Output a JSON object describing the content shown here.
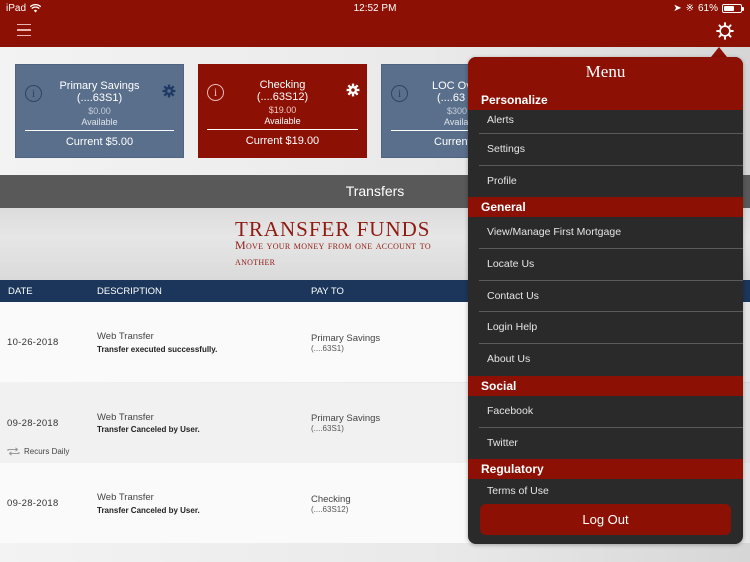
{
  "status_bar": {
    "device": "iPad",
    "time": "12:52 PM",
    "battery": "61%",
    "battery_level": 0.61
  },
  "nav": {
    "menu_icon": "hamburger-icon",
    "settings_icon": "gear-icon"
  },
  "accounts": [
    {
      "name": "Primary Savings",
      "number": "(....63S1)",
      "available_amount": "$0.00",
      "available_label": "Available",
      "current": "Current $5.00",
      "style": "blue"
    },
    {
      "name": "Checking",
      "number": "(....63S12)",
      "available_amount": "$19.00",
      "available_label": "Available",
      "current": "Current $19.00",
      "style": "red"
    },
    {
      "name": "LOC Ov",
      "number": "(....63",
      "available_amount": "$300",
      "available_label": "Availa",
      "current": "Current",
      "style": "blue"
    }
  ],
  "page": {
    "section_title": "Transfers",
    "hero_title": "TRANSFER FUNDS",
    "hero_subtitle": "Move your money from one account to another"
  },
  "table": {
    "columns": [
      "DATE",
      "DESCRIPTION",
      "PAY TO"
    ],
    "rows": [
      {
        "date": "10-26-2018",
        "description": "Web Transfer",
        "status": "Transfer executed successfully.",
        "pay_to": "Primary Savings",
        "pay_to_account": "(....63S1)",
        "recurrence": ""
      },
      {
        "date": "09-28-2018",
        "description": "Web Transfer",
        "status": "Transfer Canceled by User.",
        "pay_to": "Primary Savings",
        "pay_to_account": "(....63S1)",
        "recurrence": "Recurs Daily"
      },
      {
        "date": "09-28-2018",
        "description": "Web Transfer",
        "status": "Transfer Canceled by User.",
        "pay_to": "Checking",
        "pay_to_account": "(....63S12)",
        "recurrence": ""
      }
    ]
  },
  "menu": {
    "title": "Menu",
    "sections": [
      {
        "label": "Personalize",
        "items": [
          "Alerts",
          "Settings",
          "Profile"
        ]
      },
      {
        "label": "General",
        "items": [
          "View/Manage First Mortgage",
          "Locate Us",
          "Contact Us",
          "Login Help",
          "About Us"
        ]
      },
      {
        "label": "Social",
        "items": [
          "Facebook",
          "Twitter"
        ]
      },
      {
        "label": "Regulatory",
        "items": [
          "Terms of Use"
        ]
      }
    ],
    "logout_label": "Log Out"
  },
  "colors": {
    "brand_red": "#8c1004",
    "card_blue": "#5a6f8b",
    "table_header": "#1b365a",
    "menu_bg": "#2a2a2a"
  }
}
